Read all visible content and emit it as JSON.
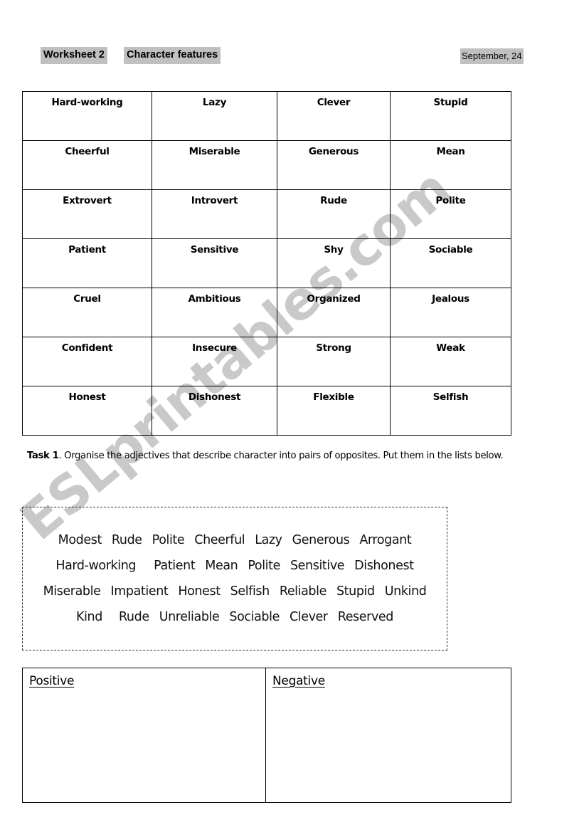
{
  "header": {
    "worksheet_title": "Worksheet 2",
    "worksheet_subtitle": "Character features",
    "date": "September, 24"
  },
  "watermark": {
    "text": "ESLprintables.com",
    "color": "#c9c9c9"
  },
  "adjectives_table": {
    "rows": [
      [
        "Hard-working",
        "Lazy",
        "Clever",
        "Stupid"
      ],
      [
        "Cheerful",
        "Miserable",
        "Generous",
        "Mean"
      ],
      [
        "Extrovert",
        "Introvert",
        "Rude",
        "Polite"
      ],
      [
        "Patient",
        "Sensitive",
        "Shy",
        "Sociable"
      ],
      [
        "Cruel",
        "Ambitious",
        "Organized",
        "Jealous"
      ],
      [
        "Confident",
        "Insecure",
        "Strong",
        "Weak"
      ],
      [
        "Honest",
        "Dishonest",
        "Flexible",
        "Selfish"
      ]
    ]
  },
  "task": {
    "label": "Task 1",
    "text": ". Organise the adjectives that describe character into pairs of opposites. Put them in the lists below."
  },
  "word_bank": {
    "lines": [
      [
        "Modest",
        "Rude",
        "Polite",
        "Cheerful",
        "Lazy",
        "Generous",
        "Arrogant"
      ],
      [
        "Hard-working",
        "Patient",
        "Mean",
        "Polite",
        "Sensitive",
        "Dishonest"
      ],
      [
        "Miserable",
        "Impatient",
        "Honest",
        "Selfish",
        "Reliable",
        "Stupid",
        "Unkind"
      ],
      [
        "Kind",
        "Rude",
        "Unreliable",
        "Sociable",
        "Clever",
        "Reserved"
      ]
    ]
  },
  "answer_table": {
    "positive_header": "Positive",
    "negative_header": "Negative",
    "positive_value": "",
    "negative_value": ""
  }
}
